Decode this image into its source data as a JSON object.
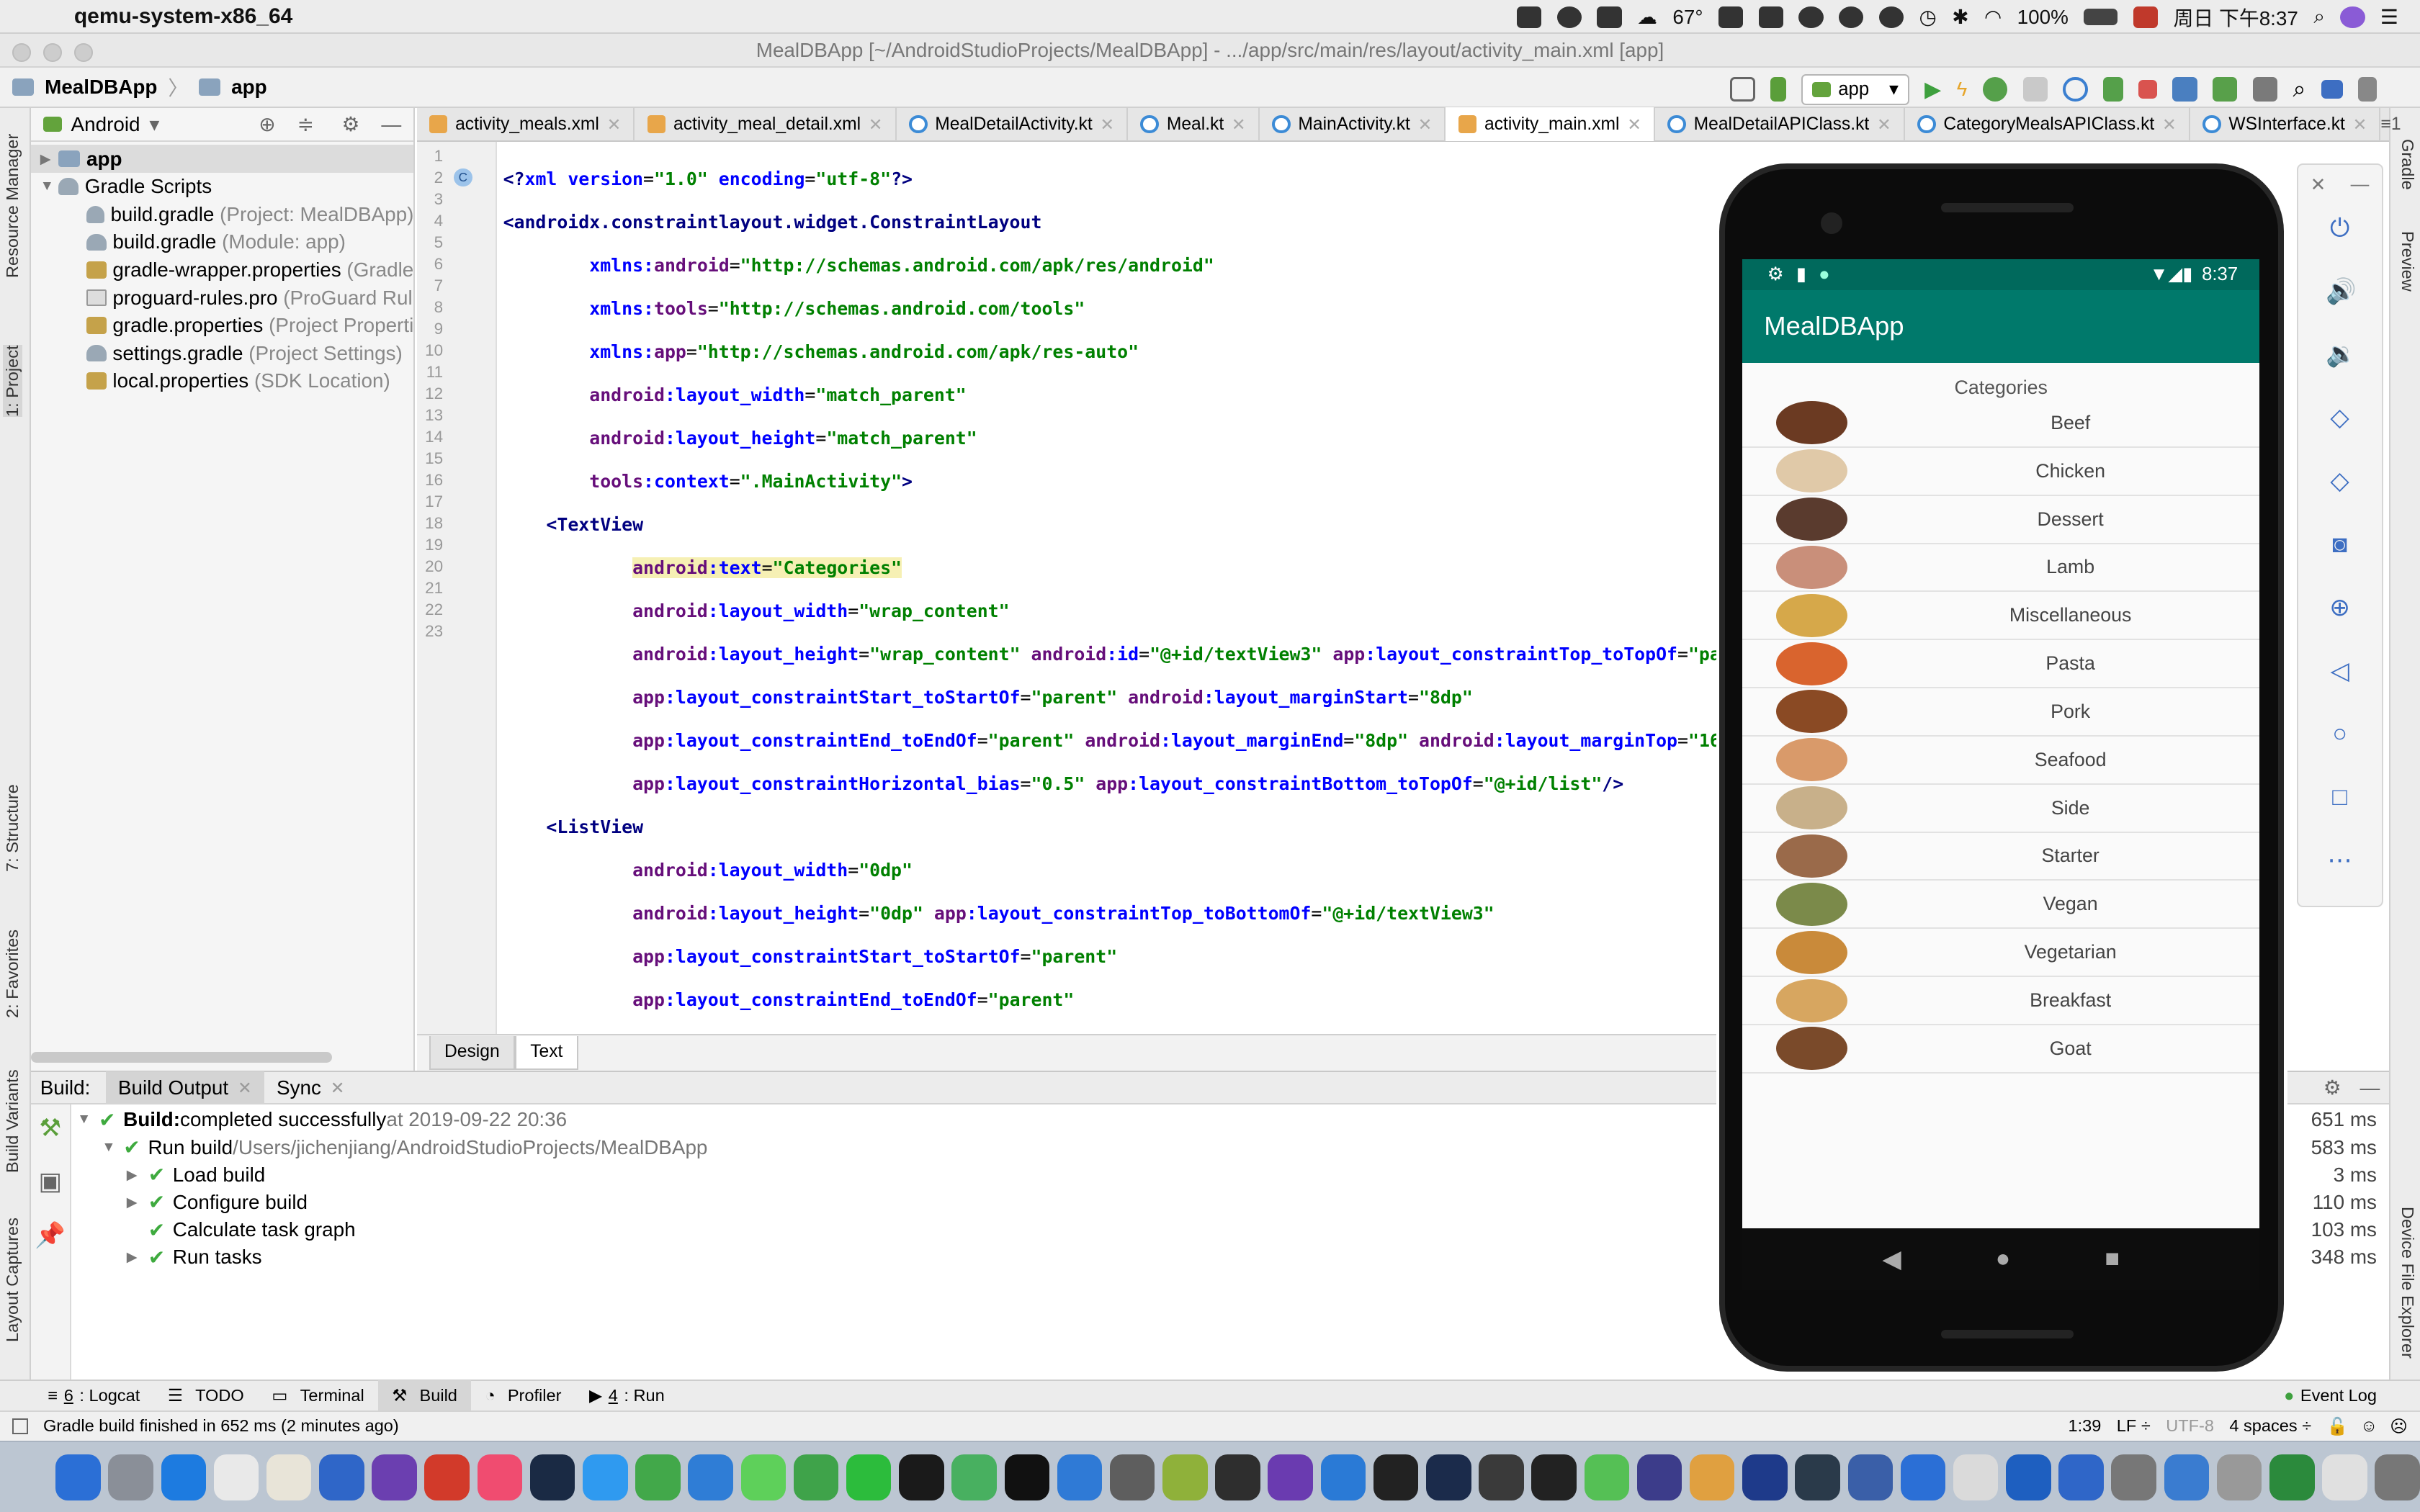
{
  "menubar": {
    "app_name": "qemu-system-x86_64",
    "temperature": "67°",
    "battery": "100%",
    "clock": "周日 下午8:37"
  },
  "window": {
    "title": "MealDBApp [~/AndroidStudioProjects/MealDBApp] - .../app/src/main/res/layout/activity_main.xml [app]"
  },
  "breadcrumb": [
    "MealDBApp",
    "app"
  ],
  "run_config": "app",
  "project_panel": {
    "view_mode": "Android",
    "tree": [
      {
        "label": "app",
        "note": ""
      },
      {
        "label": "Gradle Scripts",
        "note": ""
      },
      {
        "label": "build.gradle",
        "note": "(Project: MealDBApp)"
      },
      {
        "label": "build.gradle",
        "note": "(Module: app)"
      },
      {
        "label": "gradle-wrapper.properties",
        "note": "(Gradle"
      },
      {
        "label": "proguard-rules.pro",
        "note": "(ProGuard Rul"
      },
      {
        "label": "gradle.properties",
        "note": "(Project Properti"
      },
      {
        "label": "settings.gradle",
        "note": "(Project Settings)"
      },
      {
        "label": "local.properties",
        "note": "(SDK Location)"
      }
    ]
  },
  "tool_windows_left": [
    "Resource Manager",
    "1: Project",
    "7: Structure",
    "2: Favorites",
    "Build Variants",
    "Layout Captures"
  ],
  "tool_windows_right": [
    "Gradle",
    "Preview",
    "Device File Explorer"
  ],
  "editor_tabs": [
    {
      "label": "activity_meals.xml",
      "kind": "xml"
    },
    {
      "label": "activity_meal_detail.xml",
      "kind": "xml"
    },
    {
      "label": "MealDetailActivity.kt",
      "kind": "kt"
    },
    {
      "label": "Meal.kt",
      "kind": "kt"
    },
    {
      "label": "MainActivity.kt",
      "kind": "kt"
    },
    {
      "label": "activity_main.xml",
      "kind": "xml"
    },
    {
      "label": "MealDetailAPIClass.kt",
      "kind": "kt"
    },
    {
      "label": "CategoryMealsAPIClass.kt",
      "kind": "kt"
    },
    {
      "label": "WSInterface.kt",
      "kind": "kt"
    }
  ],
  "editor_tabs_overflow": "≡1",
  "active_tab_index": 5,
  "line_numbers": [
    "1",
    "2",
    "3",
    "4",
    "5",
    "6",
    "7",
    "8",
    "9",
    "10",
    "11",
    "12",
    "13",
    "14",
    "15",
    "16",
    "17",
    "18",
    "19",
    "20",
    "21",
    "22",
    "23"
  ],
  "design_tabs": [
    "Design",
    "Text"
  ],
  "build": {
    "header_label": "Build:",
    "tabs": [
      "Build Output",
      "Sync"
    ],
    "lines": [
      {
        "indent": 0,
        "arrow": "▼",
        "bold": "Build:",
        "text": " completed successfully",
        "extra": " at 2019-09-22 20:36",
        "time": "651 ms"
      },
      {
        "indent": 1,
        "arrow": "▼",
        "bold": "",
        "text": "Run build",
        "extra": " /Users/jichenjiang/AndroidStudioProjects/MealDBApp",
        "time": "583 ms"
      },
      {
        "indent": 2,
        "arrow": "▶",
        "bold": "",
        "text": "Load build",
        "extra": "",
        "time": "3 ms"
      },
      {
        "indent": 2,
        "arrow": "▶",
        "bold": "",
        "text": "Configure build",
        "extra": "",
        "time": "110 ms"
      },
      {
        "indent": 2,
        "arrow": "",
        "bold": "",
        "text": "Calculate task graph",
        "extra": "",
        "time": "103 ms"
      },
      {
        "indent": 2,
        "arrow": "▶",
        "bold": "",
        "text": "Run tasks",
        "extra": "",
        "time": "348 ms"
      }
    ]
  },
  "bottom_tools": [
    {
      "num": "6",
      "label": ": Logcat"
    },
    {
      "num": "",
      "label": "TODO"
    },
    {
      "num": "",
      "label": "Terminal"
    },
    {
      "num": "",
      "label": "Build"
    },
    {
      "num": "",
      "label": "Profiler"
    },
    {
      "num": "4",
      "label": ": Run"
    }
  ],
  "event_log": "Event Log",
  "status_bar": {
    "message": "Gradle build finished in 652 ms (2 minutes ago)",
    "position": "1:39",
    "line_sep": "LF ÷",
    "encoding": "UTF-8",
    "indent": "4 spaces ÷"
  },
  "phone": {
    "time": "8:37",
    "app_title": "MealDBApp",
    "list_header": "Categories",
    "categories": [
      "Beef",
      "Chicken",
      "Dessert",
      "Lamb",
      "Miscellaneous",
      "Pasta",
      "Pork",
      "Seafood",
      "Side",
      "Starter",
      "Vegan",
      "Vegetarian",
      "Breakfast",
      "Goat"
    ],
    "category_colors": [
      "#6b3a22",
      "#e0c9a8",
      "#5a3b2e",
      "#c98f7a",
      "#d6a84a",
      "#d9642e",
      "#8a4a24",
      "#d99a6a",
      "#c8b08a",
      "#9a6a4a",
      "#7b8a4a",
      "#c98a3a",
      "#d7a660",
      "#7a4a2a"
    ]
  },
  "emulator_controls": [
    "power-icon",
    "volume-up-icon",
    "volume-down-icon",
    "rotate-left-icon",
    "rotate-right-icon",
    "camera-icon",
    "zoom-icon",
    "back-icon",
    "home-icon",
    "overview-icon",
    "more-icon"
  ]
}
